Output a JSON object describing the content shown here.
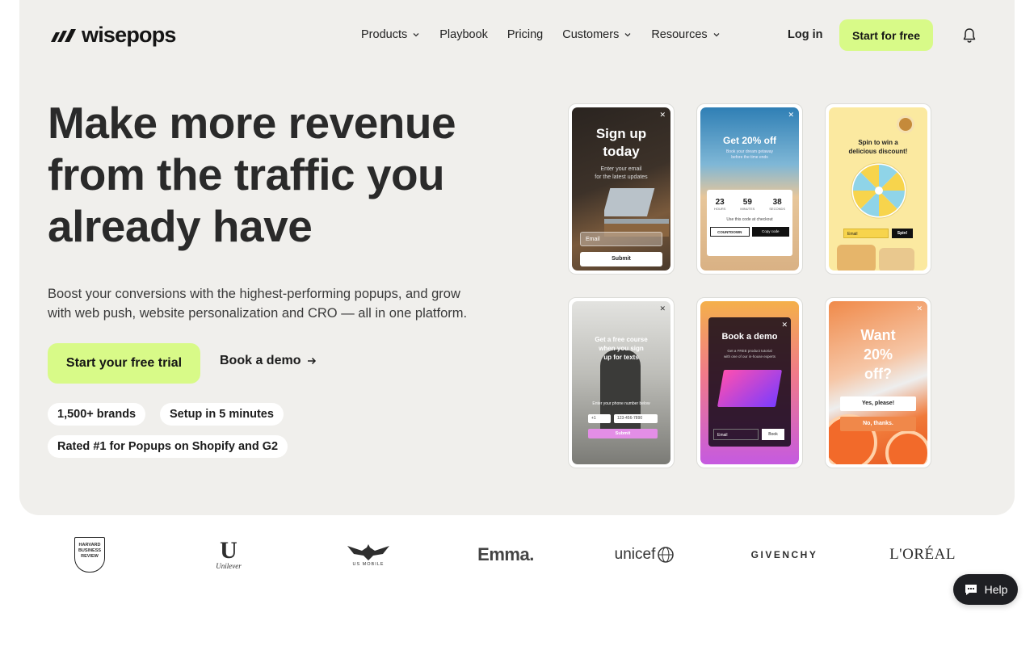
{
  "brand": {
    "name": "wisepops"
  },
  "nav": {
    "items": [
      {
        "label": "Products",
        "dropdown": true
      },
      {
        "label": "Playbook",
        "dropdown": false
      },
      {
        "label": "Pricing",
        "dropdown": false
      },
      {
        "label": "Customers",
        "dropdown": true
      },
      {
        "label": "Resources",
        "dropdown": true
      }
    ],
    "login": "Log in",
    "cta": "Start for free"
  },
  "hero": {
    "headline_lines": [
      "Make more revenue",
      "from the traffic you",
      "already have"
    ],
    "subtitle_lines": [
      "Boost your conversions with the highest-performing popups, and grow",
      "with web push, website personalization and CRO — all in one platform."
    ],
    "cta_primary": "Start your free trial",
    "cta_secondary": "Book a demo",
    "badges": [
      "1,500+ brands",
      "Setup in 5 minutes",
      "Rated #1 for Popups on Shopify and G2"
    ]
  },
  "popups": {
    "signup": {
      "title_lines": [
        "Sign up",
        "today"
      ],
      "body_lines": [
        "Enter your email",
        "for the latest updates"
      ],
      "input": "Email",
      "button": "Submit"
    },
    "discount": {
      "title": "Get 20% off",
      "body_lines": [
        "Book your dream getaway",
        "before the time ends"
      ],
      "countdown": [
        {
          "value": "23",
          "unit": "HOURS"
        },
        {
          "value": "59",
          "unit": "MINUTES"
        },
        {
          "value": "38",
          "unit": "SECONDS"
        }
      ],
      "note": "Use this code at checkout",
      "code": "COUNTDOWN",
      "copy_button": "Copy code"
    },
    "wheel": {
      "title_lines": [
        "Spin to win a",
        "delicious discount!"
      ],
      "input": "Email",
      "button": "Spin!"
    },
    "course": {
      "title_lines": [
        "Get a free course",
        "when you sign",
        "up for texts"
      ],
      "body": "Enter your phone number below",
      "country": "+1",
      "phone": "123-456-7890",
      "button": "Submit"
    },
    "demo": {
      "title": "Book a demo",
      "body_lines": [
        "Get a FREE product tutorial",
        "with one of our in-house experts"
      ],
      "input": "Email",
      "button": "Book"
    },
    "orange": {
      "title_lines": [
        "Want",
        "20%",
        "off?"
      ],
      "yes": "Yes, please!",
      "no": "No, thanks."
    }
  },
  "logos": [
    {
      "name": "harvard-business-review",
      "text_lines": [
        "HARVARD",
        "BUSINESS",
        "REVIEW"
      ]
    },
    {
      "name": "unilever",
      "text": "Unilever"
    },
    {
      "name": "us-mobile",
      "text": "US MOBILE"
    },
    {
      "name": "emma",
      "text": "Emma."
    },
    {
      "name": "unicef",
      "text": "unicef"
    },
    {
      "name": "givenchy",
      "text": "GIVENCHY"
    },
    {
      "name": "loreal",
      "text": "L'ORÉAL"
    }
  ],
  "help": {
    "label": "Help"
  },
  "colors": {
    "accent": "#d8fa88",
    "hero_bg": "#f0efec",
    "dark": "#1e1f23"
  }
}
